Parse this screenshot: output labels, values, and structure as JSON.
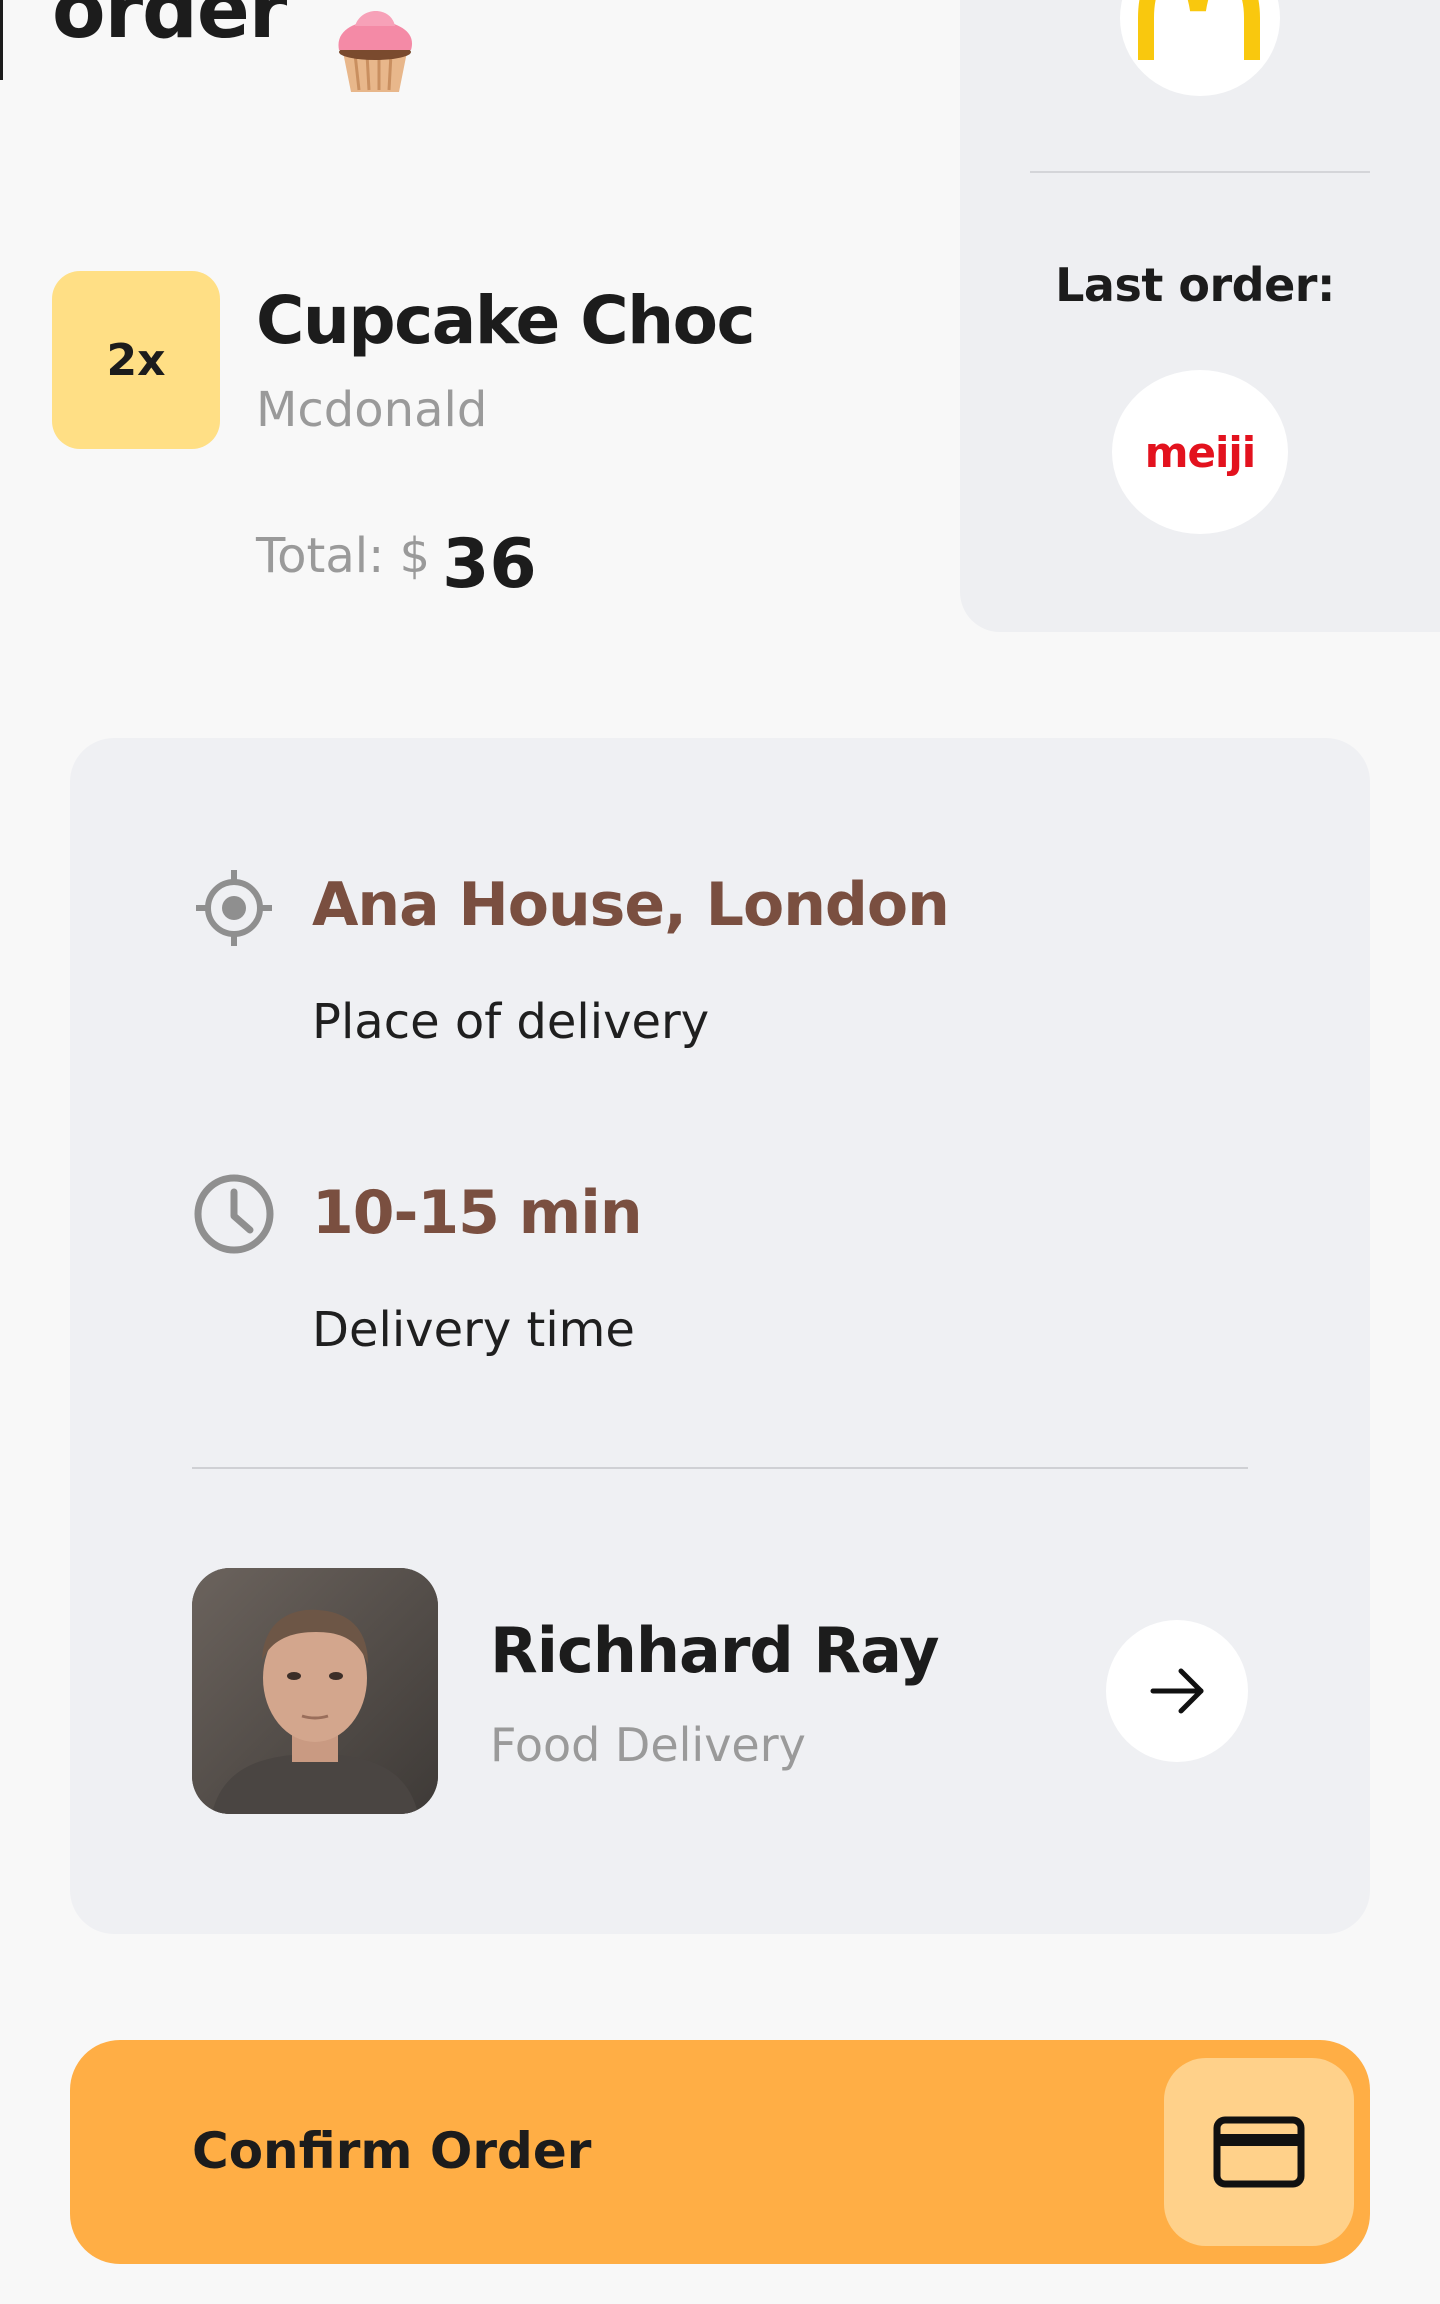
{
  "header": {
    "title": "order"
  },
  "order": {
    "quantity": "2x",
    "item_name": "Cupcake Choc",
    "brand": "Mcdonald",
    "total_label": "Total: $",
    "total_value": "36"
  },
  "side_panel": {
    "last_order_label": "Last order:",
    "last_order_brand": "meiji"
  },
  "delivery": {
    "place_title": "Ana House, London",
    "place_sub": "Place of delivery",
    "time_title": "10-15 min",
    "time_sub": "Delivery time"
  },
  "courier": {
    "name": "Richhard Ray",
    "role": "Food Delivery"
  },
  "confirm": {
    "label": "Confirm Order"
  },
  "colors": {
    "accent": "#ffae45",
    "badge": "#ffdf85",
    "title_brown": "#7a4f40",
    "meiji_red": "#e3121e"
  },
  "icons": [
    "cupcake-icon",
    "mcdonalds-logo",
    "meiji-logo",
    "location-target-icon",
    "clock-icon",
    "arrow-right-icon",
    "credit-card-icon"
  ]
}
